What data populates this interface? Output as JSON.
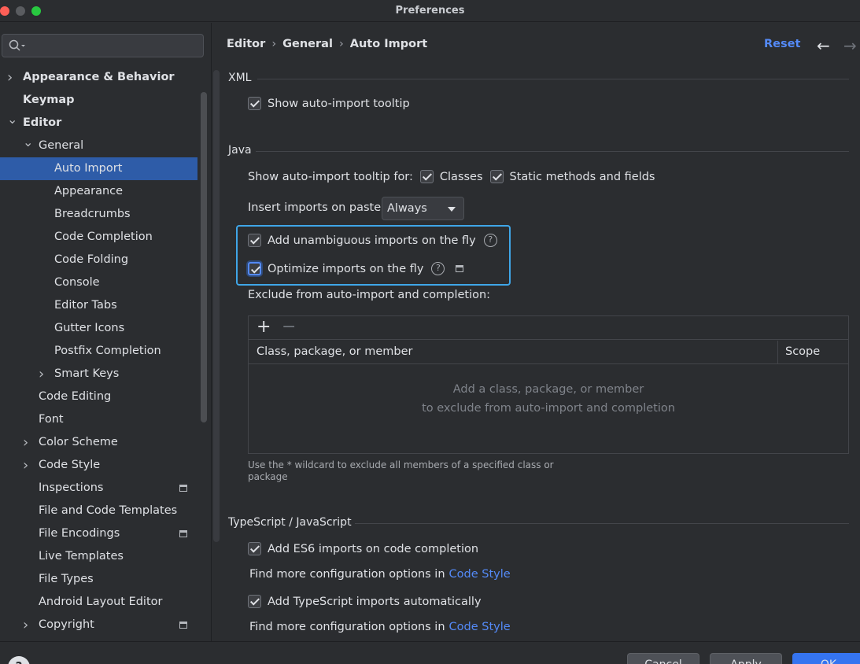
{
  "window": {
    "title": "Preferences"
  },
  "sidebar": {
    "search_placeholder": "",
    "items": [
      {
        "label": "Appearance & Behavior",
        "level": 0,
        "expand": "collapsed",
        "bold": true
      },
      {
        "label": "Keymap",
        "level": 0,
        "expand": "none",
        "bold": true
      },
      {
        "label": "Editor",
        "level": 0,
        "expand": "expanded",
        "bold": true
      },
      {
        "label": "General",
        "level": 1,
        "expand": "expanded"
      },
      {
        "label": "Auto Import",
        "level": 2,
        "expand": "none",
        "selected": true
      },
      {
        "label": "Appearance",
        "level": 2,
        "expand": "none"
      },
      {
        "label": "Breadcrumbs",
        "level": 2,
        "expand": "none"
      },
      {
        "label": "Code Completion",
        "level": 2,
        "expand": "none"
      },
      {
        "label": "Code Folding",
        "level": 2,
        "expand": "none"
      },
      {
        "label": "Console",
        "level": 2,
        "expand": "none"
      },
      {
        "label": "Editor Tabs",
        "level": 2,
        "expand": "none"
      },
      {
        "label": "Gutter Icons",
        "level": 2,
        "expand": "none"
      },
      {
        "label": "Postfix Completion",
        "level": 2,
        "expand": "none"
      },
      {
        "label": "Smart Keys",
        "level": 2,
        "expand": "collapsed"
      },
      {
        "label": "Code Editing",
        "level": 1,
        "expand": "none"
      },
      {
        "label": "Font",
        "level": 1,
        "expand": "none"
      },
      {
        "label": "Color Scheme",
        "level": 1,
        "expand": "collapsed"
      },
      {
        "label": "Code Style",
        "level": 1,
        "expand": "collapsed"
      },
      {
        "label": "Inspections",
        "level": 1,
        "expand": "none",
        "badge": true
      },
      {
        "label": "File and Code Templates",
        "level": 1,
        "expand": "none"
      },
      {
        "label": "File Encodings",
        "level": 1,
        "expand": "none",
        "badge": true
      },
      {
        "label": "Live Templates",
        "level": 1,
        "expand": "none"
      },
      {
        "label": "File Types",
        "level": 1,
        "expand": "none"
      },
      {
        "label": "Android Layout Editor",
        "level": 1,
        "expand": "none"
      },
      {
        "label": "Copyright",
        "level": 1,
        "expand": "collapsed",
        "badge": true
      }
    ]
  },
  "header": {
    "breadcrumbs": [
      "Editor",
      "General",
      "Auto Import"
    ],
    "reset_label": "Reset",
    "back_glyph": "←",
    "forward_glyph": "→"
  },
  "xml": {
    "title": "XML",
    "show_tooltip_label": "Show auto-import tooltip"
  },
  "java": {
    "title": "Java",
    "tooltip_for_label": "Show auto-import tooltip for:",
    "classes_label": "Classes",
    "static_label": "Static methods and fields",
    "paste_label": "Insert imports on paste:",
    "paste_value": "Always",
    "unambiguous_label": "Add unambiguous imports on the fly",
    "optimize_label": "Optimize imports on the fly",
    "help_glyph": "?",
    "exclude_label": "Exclude from auto-import and completion:",
    "add_glyph": "+",
    "remove_glyph": "−",
    "col_class": "Class, package, or member",
    "col_scope": "Scope",
    "empty_line1": "Add a class, package, or member",
    "empty_line2": "to exclude from auto-import and completion",
    "hint": "Use the * wildcard to exclude all members of a specified class or package"
  },
  "typescript": {
    "title": "TypeScript / JavaScript",
    "es6_label": "Add ES6 imports on code completion",
    "find_more_1": "Find more configuration options in",
    "code_style_link_1": "Code Style",
    "ts_label": "Add TypeScript imports automatically",
    "find_more_2": "Find more configuration options in",
    "code_style_link_2": "Code Style"
  },
  "footer": {
    "help_glyph": "?",
    "cancel_label": "Cancel",
    "apply_label": "Apply",
    "ok_label": "OK"
  },
  "colors": {
    "accent": "#548af7",
    "selection": "#2e5ca8",
    "highlight_box": "#3fa6e8",
    "background": "#2b2d30"
  }
}
